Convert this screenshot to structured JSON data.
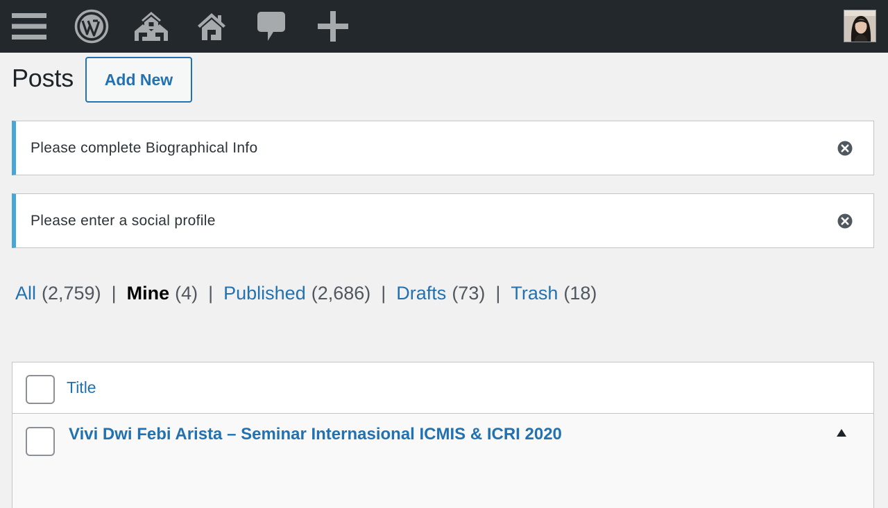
{
  "colors": {
    "adminbar_bg": "#23282d",
    "accent": "#2271b1",
    "notice_border": "#48a6d6",
    "background": "#f1f1f1"
  },
  "adminbar": {
    "icons": [
      "menu-icon",
      "wordpress-logo-icon",
      "my-sites-icon",
      "home-icon",
      "comments-icon",
      "add-new-icon"
    ],
    "avatar": "user-avatar"
  },
  "heading": {
    "title": "Posts",
    "add_new_label": "Add New"
  },
  "notices": [
    {
      "text": "Please complete Biographical Info",
      "icon": "dismiss-icon"
    },
    {
      "text": "Please enter a social profile",
      "icon": "dismiss-icon"
    }
  ],
  "filters": [
    {
      "label": "All",
      "count": "(2,759)",
      "current": false
    },
    {
      "label": "Mine",
      "count": "(4)",
      "current": true
    },
    {
      "label": "Published",
      "count": "(2,686)",
      "current": false
    },
    {
      "label": "Drafts",
      "count": "(73)",
      "current": false
    },
    {
      "label": "Trash",
      "count": "(18)",
      "current": false
    }
  ],
  "filter_separator": "|",
  "table": {
    "column_title": "Title",
    "rows": [
      {
        "title": "Vivi Dwi Febi Arista – Seminar Internasional ICMIS & ICRI 2020",
        "checked": false
      }
    ]
  }
}
